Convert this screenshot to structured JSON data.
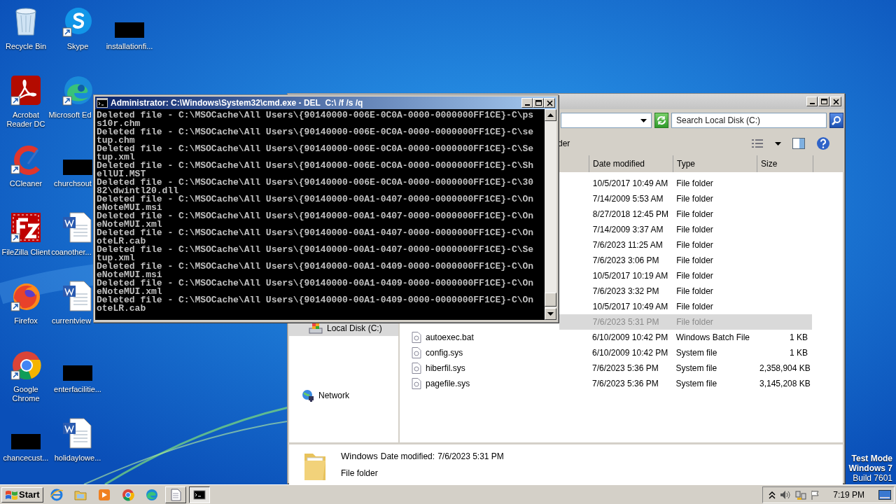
{
  "desktop_icon_rows": [
    [
      {
        "label": "Recycle Bin",
        "kind": "recycle",
        "shortcut": false
      },
      {
        "label": "Skype",
        "kind": "skype",
        "shortcut": true
      },
      {
        "label": "installationfi...",
        "kind": "redacted"
      }
    ],
    [
      {
        "label": "Acrobat Reader DC",
        "kind": "acrobat",
        "shortcut": true
      },
      {
        "label": "Microsoft Ed",
        "kind": "edge",
        "shortcut": true
      }
    ],
    [
      {
        "label": "CCleaner",
        "kind": "ccleaner",
        "shortcut": true
      },
      {
        "label": "churchsout",
        "kind": "redacted"
      }
    ],
    [
      {
        "label": "FileZilla Client",
        "kind": "filezilla",
        "shortcut": true
      },
      {
        "label": "coanother...",
        "kind": "word",
        "shortcut": false
      }
    ],
    [
      {
        "label": "Firefox",
        "kind": "firefox",
        "shortcut": true
      },
      {
        "label": "currentview",
        "kind": "word",
        "shortcut": false
      }
    ],
    [
      {
        "label": "Google Chrome",
        "kind": "chrome",
        "shortcut": true
      },
      {
        "label": "enterfacilitie...",
        "kind": "redacted"
      }
    ],
    [
      {
        "label": "chancecust...",
        "kind": "redacted"
      },
      {
        "label": "holidaylowe...",
        "kind": "word",
        "shortcut": false
      }
    ]
  ],
  "cmd_window": {
    "title": "Administrator: C:\\Windows\\System32\\cmd.exe - DEL  C:\\ /f /s /q",
    "lines": [
      "Deleted file - C:\\MSOCache\\All Users\\{90140000-006E-0C0A-0000-0000000FF1CE}-C\\ps",
      "s10r.chm",
      "Deleted file - C:\\MSOCache\\All Users\\{90140000-006E-0C0A-0000-0000000FF1CE}-C\\se",
      "tup.chm",
      "Deleted file - C:\\MSOCache\\All Users\\{90140000-006E-0C0A-0000-0000000FF1CE}-C\\Se",
      "tup.xml",
      "Deleted file - C:\\MSOCache\\All Users\\{90140000-006E-0C0A-0000-0000000FF1CE}-C\\Sh",
      "ellUI.MST",
      "Deleted file - C:\\MSOCache\\All Users\\{90140000-006E-0C0A-0000-0000000FF1CE}-C\\30",
      "82\\dwintl20.dll",
      "Deleted file - C:\\MSOCache\\All Users\\{90140000-00A1-0407-0000-0000000FF1CE}-C\\On",
      "eNoteMUI.msi",
      "Deleted file - C:\\MSOCache\\All Users\\{90140000-00A1-0407-0000-0000000FF1CE}-C\\On",
      "eNoteMUI.xml",
      "Deleted file - C:\\MSOCache\\All Users\\{90140000-00A1-0407-0000-0000000FF1CE}-C\\On",
      "oteLR.cab",
      "Deleted file - C:\\MSOCache\\All Users\\{90140000-00A1-0407-0000-0000000FF1CE}-C\\Se",
      "tup.xml",
      "Deleted file - C:\\MSOCache\\All Users\\{90140000-00A1-0409-0000-0000000FF1CE}-C\\On",
      "eNoteMUI.msi",
      "Deleted file - C:\\MSOCache\\All Users\\{90140000-00A1-0409-0000-0000000FF1CE}-C\\On",
      "eNoteMUI.xml",
      "Deleted file - C:\\MSOCache\\All Users\\{90140000-00A1-0409-0000-0000000FF1CE}-C\\On",
      "oteLR.cab"
    ]
  },
  "explorer_window": {
    "search": {
      "placeholder": "Search Local Disk (C:)"
    },
    "toolbar_fragment": "der",
    "columns": [
      "Date modified",
      "Type",
      "Size"
    ],
    "nav_items": [
      {
        "label": "Local Disk (C:)",
        "kind": "drive",
        "selected": true
      },
      {
        "label": "Network",
        "kind": "network",
        "selected": false
      }
    ],
    "rows": [
      {
        "date": "10/5/2017 10:49 AM",
        "type": "File folder",
        "selected": false
      },
      {
        "date": "7/14/2009 5:53 AM",
        "type": "File folder",
        "selected": false
      },
      {
        "date": "8/27/2018 12:45 PM",
        "type": "File folder",
        "selected": false
      },
      {
        "date": "7/14/2009 3:37 AM",
        "type": "File folder",
        "selected": false
      },
      {
        "date": "7/6/2023 11:25 AM",
        "type": "File folder",
        "selected": false
      },
      {
        "date": "7/6/2023 3:06 PM",
        "type": "File folder",
        "selected": false
      },
      {
        "date": "10/5/2017 10:19 AM",
        "type": "File folder",
        "selected": false
      },
      {
        "date": "7/6/2023 3:32 PM",
        "type": "File folder",
        "selected": false
      },
      {
        "date": "10/5/2017 10:49 AM",
        "type": "File folder",
        "selected": false
      },
      {
        "date": "7/6/2023 5:31 PM",
        "type": "File folder",
        "selected": true
      },
      {
        "name": "autoexec.bat",
        "date": "6/10/2009 10:42 PM",
        "type": "Windows Batch File",
        "size": "1 KB",
        "selected": false
      },
      {
        "name": "config.sys",
        "date": "6/10/2009 10:42 PM",
        "type": "System file",
        "size": "1 KB",
        "selected": false
      },
      {
        "name": "hiberfil.sys",
        "date": "7/6/2023 5:36 PM",
        "type": "System file",
        "size": "2,358,904 KB",
        "selected": false
      },
      {
        "name": "pagefile.sys",
        "date": "7/6/2023 5:36 PM",
        "type": "System file",
        "size": "3,145,208 KB",
        "selected": false
      }
    ],
    "details": {
      "name": "Windows",
      "date_label": "Date modified:",
      "date": "7/6/2023 5:31 PM",
      "type": "File folder"
    }
  },
  "watermark_text": [
    "Test Mode",
    "Windows 7",
    "Build 7601"
  ],
  "taskbar": {
    "start": "Start",
    "items": [
      {
        "kind": "ie",
        "open": false,
        "selected": false
      },
      {
        "kind": "folder",
        "open": false,
        "selected": false
      },
      {
        "kind": "media",
        "open": false,
        "selected": false
      },
      {
        "kind": "chrome",
        "open": false,
        "selected": false
      },
      {
        "kind": "edge",
        "open": false,
        "selected": false
      },
      {
        "kind": "notepad",
        "open": true,
        "selected": false
      },
      {
        "kind": "cmd",
        "open": true,
        "selected": true
      }
    ],
    "clock": "7:19 PM"
  }
}
